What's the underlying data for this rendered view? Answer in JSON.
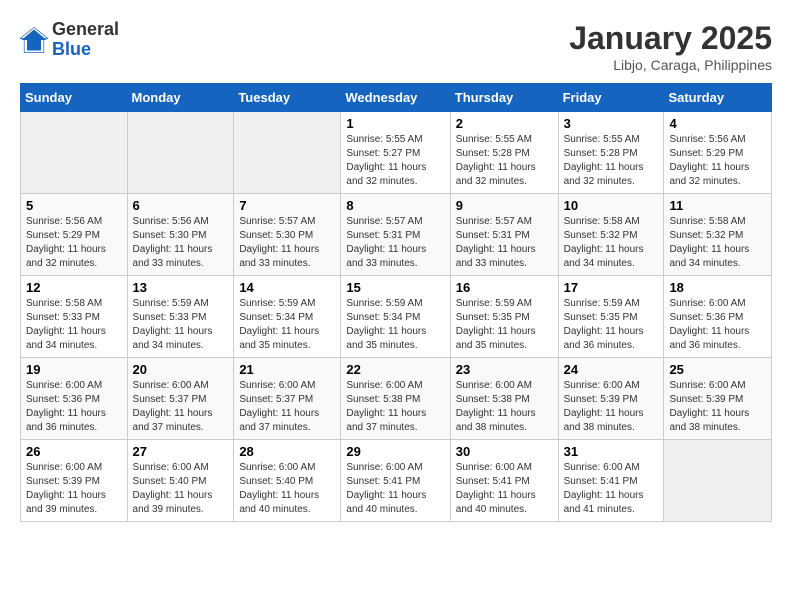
{
  "logo": {
    "general": "General",
    "blue": "Blue"
  },
  "title": "January 2025",
  "subtitle": "Libjo, Caraga, Philippines",
  "headers": [
    "Sunday",
    "Monday",
    "Tuesday",
    "Wednesday",
    "Thursday",
    "Friday",
    "Saturday"
  ],
  "weeks": [
    [
      {
        "day": "",
        "info": ""
      },
      {
        "day": "",
        "info": ""
      },
      {
        "day": "",
        "info": ""
      },
      {
        "day": "1",
        "info": "Sunrise: 5:55 AM\nSunset: 5:27 PM\nDaylight: 11 hours\nand 32 minutes."
      },
      {
        "day": "2",
        "info": "Sunrise: 5:55 AM\nSunset: 5:28 PM\nDaylight: 11 hours\nand 32 minutes."
      },
      {
        "day": "3",
        "info": "Sunrise: 5:55 AM\nSunset: 5:28 PM\nDaylight: 11 hours\nand 32 minutes."
      },
      {
        "day": "4",
        "info": "Sunrise: 5:56 AM\nSunset: 5:29 PM\nDaylight: 11 hours\nand 32 minutes."
      }
    ],
    [
      {
        "day": "5",
        "info": "Sunrise: 5:56 AM\nSunset: 5:29 PM\nDaylight: 11 hours\nand 32 minutes."
      },
      {
        "day": "6",
        "info": "Sunrise: 5:56 AM\nSunset: 5:30 PM\nDaylight: 11 hours\nand 33 minutes."
      },
      {
        "day": "7",
        "info": "Sunrise: 5:57 AM\nSunset: 5:30 PM\nDaylight: 11 hours\nand 33 minutes."
      },
      {
        "day": "8",
        "info": "Sunrise: 5:57 AM\nSunset: 5:31 PM\nDaylight: 11 hours\nand 33 minutes."
      },
      {
        "day": "9",
        "info": "Sunrise: 5:57 AM\nSunset: 5:31 PM\nDaylight: 11 hours\nand 33 minutes."
      },
      {
        "day": "10",
        "info": "Sunrise: 5:58 AM\nSunset: 5:32 PM\nDaylight: 11 hours\nand 34 minutes."
      },
      {
        "day": "11",
        "info": "Sunrise: 5:58 AM\nSunset: 5:32 PM\nDaylight: 11 hours\nand 34 minutes."
      }
    ],
    [
      {
        "day": "12",
        "info": "Sunrise: 5:58 AM\nSunset: 5:33 PM\nDaylight: 11 hours\nand 34 minutes."
      },
      {
        "day": "13",
        "info": "Sunrise: 5:59 AM\nSunset: 5:33 PM\nDaylight: 11 hours\nand 34 minutes."
      },
      {
        "day": "14",
        "info": "Sunrise: 5:59 AM\nSunset: 5:34 PM\nDaylight: 11 hours\nand 35 minutes."
      },
      {
        "day": "15",
        "info": "Sunrise: 5:59 AM\nSunset: 5:34 PM\nDaylight: 11 hours\nand 35 minutes."
      },
      {
        "day": "16",
        "info": "Sunrise: 5:59 AM\nSunset: 5:35 PM\nDaylight: 11 hours\nand 35 minutes."
      },
      {
        "day": "17",
        "info": "Sunrise: 5:59 AM\nSunset: 5:35 PM\nDaylight: 11 hours\nand 36 minutes."
      },
      {
        "day": "18",
        "info": "Sunrise: 6:00 AM\nSunset: 5:36 PM\nDaylight: 11 hours\nand 36 minutes."
      }
    ],
    [
      {
        "day": "19",
        "info": "Sunrise: 6:00 AM\nSunset: 5:36 PM\nDaylight: 11 hours\nand 36 minutes."
      },
      {
        "day": "20",
        "info": "Sunrise: 6:00 AM\nSunset: 5:37 PM\nDaylight: 11 hours\nand 37 minutes."
      },
      {
        "day": "21",
        "info": "Sunrise: 6:00 AM\nSunset: 5:37 PM\nDaylight: 11 hours\nand 37 minutes."
      },
      {
        "day": "22",
        "info": "Sunrise: 6:00 AM\nSunset: 5:38 PM\nDaylight: 11 hours\nand 37 minutes."
      },
      {
        "day": "23",
        "info": "Sunrise: 6:00 AM\nSunset: 5:38 PM\nDaylight: 11 hours\nand 38 minutes."
      },
      {
        "day": "24",
        "info": "Sunrise: 6:00 AM\nSunset: 5:39 PM\nDaylight: 11 hours\nand 38 minutes."
      },
      {
        "day": "25",
        "info": "Sunrise: 6:00 AM\nSunset: 5:39 PM\nDaylight: 11 hours\nand 38 minutes."
      }
    ],
    [
      {
        "day": "26",
        "info": "Sunrise: 6:00 AM\nSunset: 5:39 PM\nDaylight: 11 hours\nand 39 minutes."
      },
      {
        "day": "27",
        "info": "Sunrise: 6:00 AM\nSunset: 5:40 PM\nDaylight: 11 hours\nand 39 minutes."
      },
      {
        "day": "28",
        "info": "Sunrise: 6:00 AM\nSunset: 5:40 PM\nDaylight: 11 hours\nand 40 minutes."
      },
      {
        "day": "29",
        "info": "Sunrise: 6:00 AM\nSunset: 5:41 PM\nDaylight: 11 hours\nand 40 minutes."
      },
      {
        "day": "30",
        "info": "Sunrise: 6:00 AM\nSunset: 5:41 PM\nDaylight: 11 hours\nand 40 minutes."
      },
      {
        "day": "31",
        "info": "Sunrise: 6:00 AM\nSunset: 5:41 PM\nDaylight: 11 hours\nand 41 minutes."
      },
      {
        "day": "",
        "info": ""
      }
    ]
  ]
}
